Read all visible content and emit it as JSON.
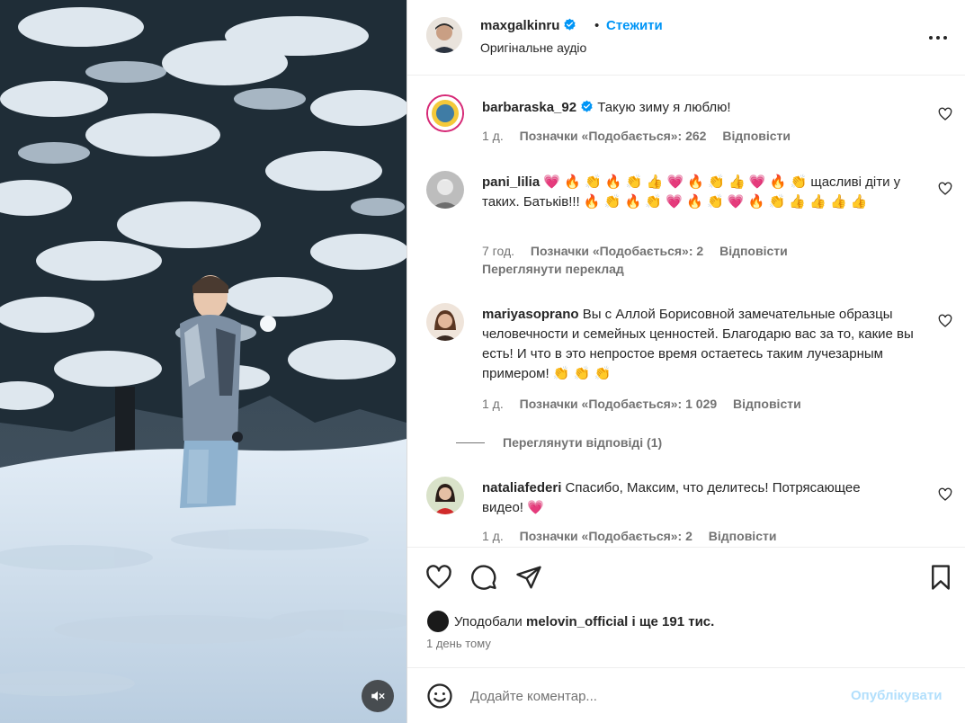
{
  "post": {
    "author": "maxgalkinru",
    "dot": "•",
    "follow_label": "Стежити",
    "audio_label": "Оригінальне аудіо",
    "verified_color": "#0095f6"
  },
  "comments": [
    {
      "user": "barbaraska_92",
      "text": "Такую зиму я люблю!",
      "time": "1 д.",
      "likes": "Позначки «Подобається»: 262",
      "reply": "Відповісти"
    },
    {
      "user": "pani_lilia",
      "text": "💗 🔥 👏 🔥 👏 👍 💗 🔥 👏 👍 💗 🔥 👏 щасливі діти у таких. Батьків!!! 🔥 👏 🔥 👏 💗 🔥 👏 💗 🔥 👏 👍 👍 👍 👍",
      "time": "7 год.",
      "likes": "Позначки «Подобається»: 2",
      "reply": "Відповісти",
      "translate": "Переглянути переклад"
    },
    {
      "user": "mariyasoprano",
      "text": "Вы с Аллой Борисовной замечательные образцы человечности и семейных ценностей. Благодарю вас за то, какие вы есть! И что в это непростое время остаетесь таким лучезарным примером! 👏 👏 👏",
      "time": "1 д.",
      "likes": "Позначки «Подобається»: 1 029",
      "reply": "Відповісти",
      "view_replies": "Переглянути відповіді (1)"
    },
    {
      "user": "nataliafederi",
      "text": "Спасибо, Максим, что делитесь! Потрясающее видео! 💗",
      "time": "1 д.",
      "likes": "Позначки «Подобається»: 2",
      "reply": "Відповісти"
    }
  ],
  "footer": {
    "liked_prefix": "Уподобали",
    "liked_user": "melovin_official",
    "liked_rest": "і ще 191 тис.",
    "time_ago": "1 день тому",
    "comment_placeholder": "Додайте коментар...",
    "publish_label": "Опублікувати"
  },
  "icons": {
    "header": [
      "verified-badge-icon",
      "more-options-icon"
    ],
    "media": [
      "muted-speaker-icon"
    ],
    "actions": [
      "heart-icon",
      "comment-icon",
      "share-icon",
      "bookmark-icon",
      "emoji-icon"
    ]
  },
  "colors": {
    "accent": "#0095f6",
    "publish_disabled": "#b2dffc",
    "muted_text": "#737373",
    "heart_emoji": "#e8305a"
  }
}
